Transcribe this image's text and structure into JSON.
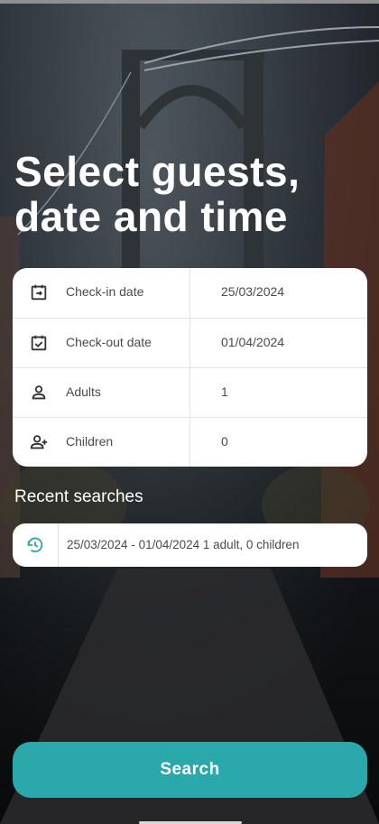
{
  "page": {
    "title": "Select guests, date and time"
  },
  "fields": [
    {
      "icon": "calendar-arrow-icon",
      "label": "Check-in date",
      "value": "25/03/2024"
    },
    {
      "icon": "calendar-check-icon",
      "label": "Check-out date",
      "value": "01/04/2024"
    },
    {
      "icon": "person-icon",
      "label": "Adults",
      "value": "1"
    },
    {
      "icon": "person-add-icon",
      "label": "Children",
      "value": "0"
    }
  ],
  "recent": {
    "heading": "Recent searches",
    "icon": "history-icon",
    "items": [
      {
        "text": "25/03/2024 - 01/04/2024  1 adult, 0 children"
      }
    ]
  },
  "search_button": {
    "label": "Search"
  },
  "colors": {
    "accent": "#2aa8aa",
    "card": "#ffffff",
    "text": "#4a4a4a"
  }
}
